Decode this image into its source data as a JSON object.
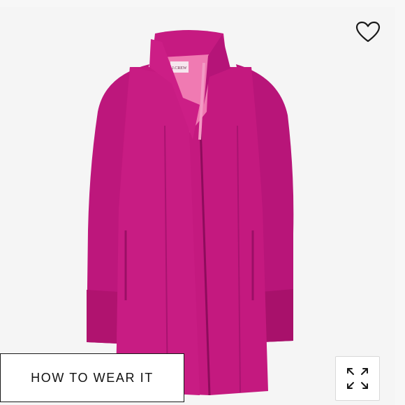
{
  "product_image": {
    "subject": "magenta wool coat",
    "brand_label": "J.CREW",
    "colors": {
      "coat": "#c0187f",
      "coat_shadow": "#a01068",
      "lining": "#f07ab2",
      "background": "#f5f5f5"
    }
  },
  "actions": {
    "how_to_wear_label": "HOW TO WEAR IT",
    "favorite_icon": "heart-outline-icon",
    "expand_icon": "expand-arrows-icon"
  }
}
